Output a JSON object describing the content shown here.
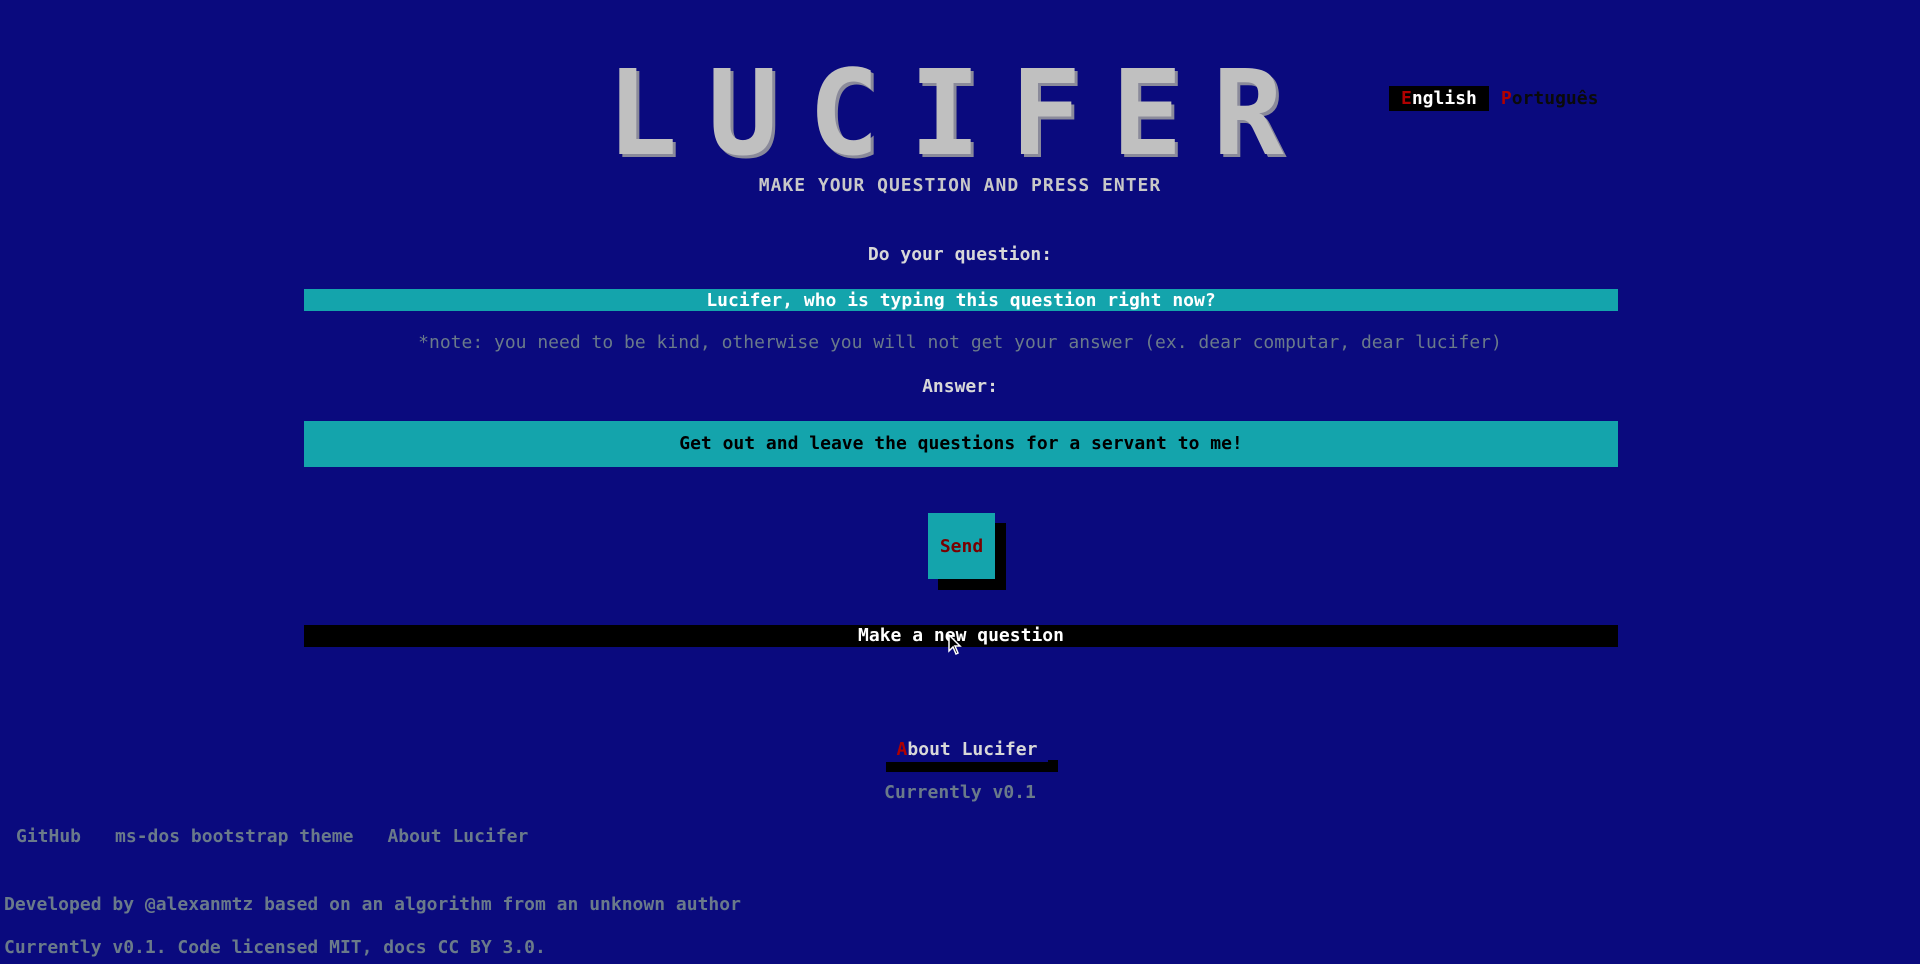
{
  "header": {
    "title": "LUCIFER",
    "subtitle": "MAKE YOUR QUESTION AND PRESS ENTER"
  },
  "language": {
    "english_hot": "E",
    "english_rest": "nglish",
    "portuguese_hot": "P",
    "portuguese_rest": "ortuguês"
  },
  "form": {
    "question_label": "Do your question:",
    "question_value": "Lucifer, who is typing this question right now?",
    "note": "*note: you need to be kind, otherwise you will not get your answer (ex. dear computar, dear lucifer)",
    "answer_label": "Answer:",
    "answer_value": "Get out and leave the questions for a servant to me!",
    "send_label": "Send",
    "new_question_label": "Make a new question"
  },
  "about": {
    "button_hot": "A",
    "button_rest": "bout Lucifer",
    "version": "Currently v0.1"
  },
  "footer": {
    "links": [
      "GitHub",
      "ms-dos bootstrap theme",
      "About Lucifer"
    ],
    "developed_by": "Developed by @alexanmtz based on an algorithm from an unknown author",
    "license": "Currently v0.1. Code licensed MIT, docs CC BY 3.0."
  },
  "colors": {
    "background": "#0a0a7e",
    "accent_teal": "#14a4ac",
    "hotkey_red": "#b00000"
  }
}
